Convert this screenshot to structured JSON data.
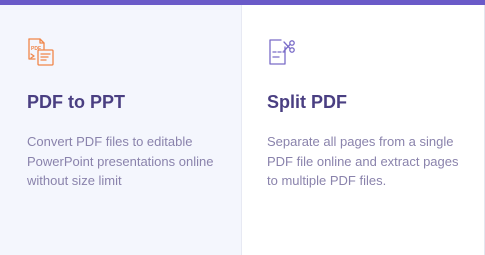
{
  "colors": {
    "accent_bar": "#6a5ac8",
    "title": "#4a3f82",
    "description": "#8a83ac",
    "pdf_to_ppt_icon": "#f0864a",
    "split_pdf_icon": "#7a6cc8"
  },
  "cards": [
    {
      "icon": "pdf-to-ppt-icon",
      "title": "PDF to PPT",
      "description": "Convert PDF files to editable PowerPoint presentations online without size limit"
    },
    {
      "icon": "split-pdf-scissors-icon",
      "title": "Split PDF",
      "description": "Separate all pages from a single PDF file online and extract pages to multiple PDF files."
    }
  ]
}
